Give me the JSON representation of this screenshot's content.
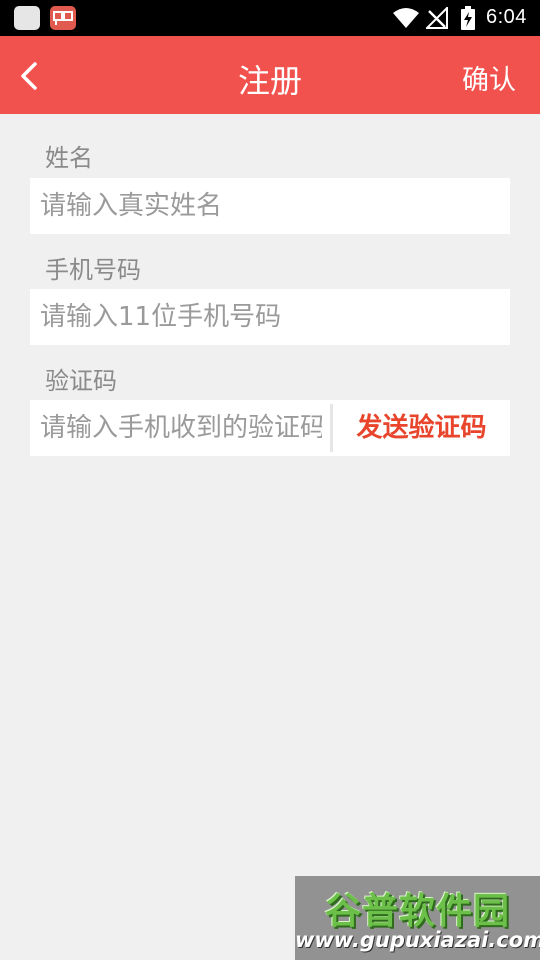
{
  "status_bar": {
    "time": "6:04",
    "icons": [
      "app-icon",
      "app-icon-red",
      "wifi-icon",
      "no-signal-icon",
      "battery-charging-icon"
    ]
  },
  "header": {
    "title": "注册",
    "confirm_label": "确认",
    "back_icon": "chevron-left-icon",
    "background_color": "#f2524d"
  },
  "form": {
    "name": {
      "label": "姓名",
      "placeholder": "请输入真实姓名",
      "value": ""
    },
    "phone": {
      "label": "手机号码",
      "placeholder": "请输入11位手机号码",
      "value": ""
    },
    "code": {
      "label": "验证码",
      "placeholder": "请输入手机收到的验证码",
      "value": "",
      "send_label": "发送验证码",
      "send_color": "#e8452c"
    }
  },
  "watermark": {
    "logo_text": "谷普软件园",
    "url": "www.gupuxiazai.com"
  }
}
